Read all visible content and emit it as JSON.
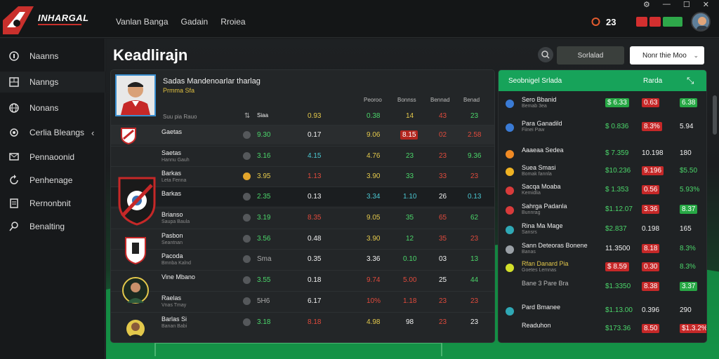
{
  "app": {
    "logo_text": "INHARGAL",
    "brand_color": "#c9302c",
    "accent_green": "#17a35a"
  },
  "topnav": [
    "Vanlan Banga",
    "Gadain",
    "Rroiea"
  ],
  "topright": {
    "count": "23"
  },
  "sidebar": {
    "items": [
      {
        "label": "Naanns",
        "icon": "user-icon"
      },
      {
        "label": "Nanngs",
        "icon": "grid-icon"
      },
      {
        "label": "Nonans",
        "icon": "globe-icon"
      },
      {
        "label": "Cerlia Bleangs",
        "icon": "settings-icon"
      },
      {
        "label": "Pennaoonid",
        "icon": "message-icon"
      },
      {
        "label": "Penhenage",
        "icon": "refresh-icon"
      },
      {
        "label": "Rernonbnit",
        "icon": "document-icon"
      },
      {
        "label": "Benalting",
        "icon": "search-icon"
      }
    ]
  },
  "page": {
    "title": "Keadlirajn",
    "action_button": "Sorlalad",
    "select_value": "Nonr thie Moo"
  },
  "stats": {
    "title": "Sadas Mandenoarlar tharlag",
    "subtitle": "Prmma Sfa",
    "meta": "Suu pia Rauo",
    "headers": [
      "Peoroo",
      "Bonnss",
      "Bennad",
      "Benad"
    ],
    "top_row": {
      "col1": "Siaa",
      "v1": "0.93",
      "v2": "0.38",
      "v3": "14",
      "v4": "43",
      "v5": "23"
    },
    "rows": [
      {
        "name": "Gaetas",
        "sub": "",
        "a": "9.30",
        "b": "0.17",
        "c": "9.06",
        "d": "8.15",
        "e": "02",
        "f": "2.58"
      },
      {
        "name": "Saetas",
        "sub": "Hannu Gauh",
        "a": "3.16",
        "b": "4.15",
        "c": "4.76",
        "d": "23",
        "e": "23",
        "f": "9.36"
      },
      {
        "name": "Barkas",
        "sub": "Leta Fenna",
        "a": "3.95",
        "b": "1.13",
        "c": "3.90",
        "d": "33",
        "e": "33",
        "f": "23"
      },
      {
        "name": "Barkas",
        "sub": "",
        "a": "2.35",
        "b": "0.13",
        "c": "3.34",
        "d": "1.10",
        "e": "26",
        "f": "0.13"
      },
      {
        "name": "Brianso",
        "sub": "Saupa Baula",
        "a": "3.19",
        "b": "8.35",
        "c": "9.05",
        "d": "35",
        "e": "65",
        "f": "62"
      },
      {
        "name": "Pasbon",
        "sub": "Seantnan",
        "a": "3.56",
        "b": "0.48",
        "c": "3.90",
        "d": "12",
        "e": "35",
        "f": "23"
      },
      {
        "name": "Pacoda",
        "sub": "Bmnba Kalnd",
        "a": "Sma",
        "b": "0.35",
        "c": "3.36",
        "d": "0.10",
        "e": "03",
        "f": "13"
      },
      {
        "name": "Vine Mbano",
        "sub": "",
        "a": "3.55",
        "b": "0.18",
        "c": "9.74",
        "d": "5.00",
        "e": "25",
        "f": "44"
      },
      {
        "name": "Raelas",
        "sub": "Vnas Tmay",
        "a": "5H6",
        "b": "6.17",
        "c": "10%",
        "d": "1.18",
        "e": "23",
        "f": "23"
      },
      {
        "name": "Barlas Si",
        "sub": "Banan Babi",
        "a": "3.18",
        "b": "8.18",
        "c": "4.98",
        "d": "98",
        "e": "23",
        "f": "23"
      }
    ]
  },
  "odds": {
    "header": "Seobnigel Srlada",
    "header_right": "Rarda",
    "rows": [
      {
        "name": "Sero Bbanid",
        "sub": "Bemab 3ea",
        "v1": "$ 6.33",
        "v2": "0.63",
        "v3": "6.38",
        "dot": "#3a7bd5"
      },
      {
        "name": "Para Ganadild",
        "sub": "Fiinei Paw",
        "v1": "$ 0.836",
        "v2": "8.3%",
        "v3": "5.94",
        "dot": "#3a7bd5"
      },
      {
        "name": "Aaaeaa Sedea",
        "sub": "",
        "v1": "$ 7.359",
        "v2": "10.198",
        "v3": "180",
        "dot": "#f08a24"
      },
      {
        "name": "Suea Smasi",
        "sub": "Bomak fannla",
        "v1": "$10.236",
        "v2": "9.196",
        "v3": "$5.50",
        "dot": "#f0b323"
      },
      {
        "name": "Sacqa Moaba",
        "sub": "Kemidlia",
        "v1": "$ 1.353",
        "v2": "0.56",
        "v3": "5.93%",
        "dot": "#d83b3b"
      },
      {
        "name": "Sahrga Padanla",
        "sub": "Bunnrag",
        "v1": "$1.12.07",
        "v2": "3.36",
        "v3": "8.37",
        "dot": "#d83b3b"
      },
      {
        "name": "Rina Ma Mage",
        "sub": "Sansrs",
        "v1": "$2.837",
        "v2": "0.198",
        "v3": "165",
        "dot": "#2fa8b5"
      },
      {
        "name": "Sann Deteoras Bonene",
        "sub": "Banas",
        "v1": "11.3500",
        "v2": "8.18",
        "v3": "8.3%",
        "dot": "#9aa0a6"
      },
      {
        "name": "Rfan Danard Pia",
        "sub": "Goetes Lemnas",
        "v1": "$ 8.59",
        "v2": "0.30",
        "v3": "8.3%",
        "dot": "#d3e02a"
      },
      {
        "name": "Bane 3 Pare Bra",
        "sub": "",
        "v1": "$1.3350",
        "v2": "8.38",
        "v3": "3.37",
        "dot": "#9aa0a6"
      },
      {
        "name": "Pard Bmanee",
        "sub": "",
        "v1": "$1.13.00",
        "v2": "0.396",
        "v3": "290",
        "dot": "#2fa8b5"
      },
      {
        "name": "Readuhon",
        "sub": "",
        "v1": "$173.36",
        "v2": "8.50",
        "v3": "$1.3.2%",
        "dot": "#9aa0a6"
      }
    ]
  }
}
